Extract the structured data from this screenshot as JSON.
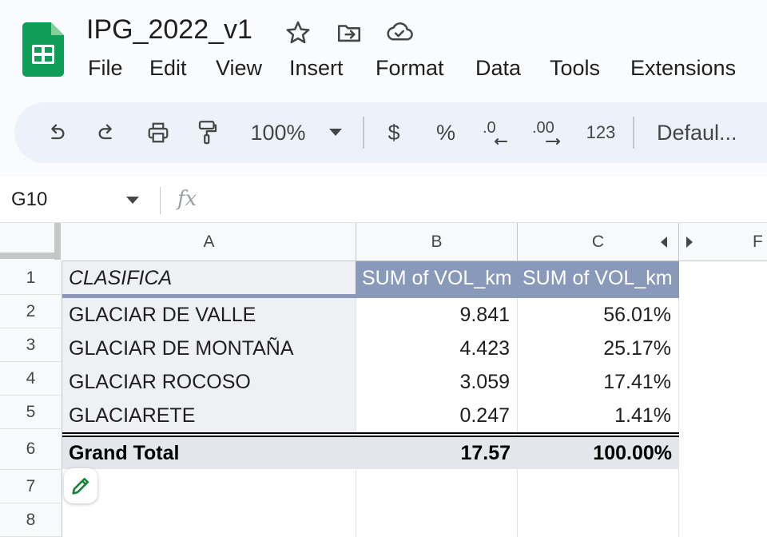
{
  "document": {
    "title": "IPG_2022_v1",
    "icons": [
      "star-icon",
      "move-to-folder-icon",
      "cloud-saved-icon"
    ]
  },
  "menu": [
    "File",
    "Edit",
    "View",
    "Insert",
    "Format",
    "Data",
    "Tools",
    "Extensions"
  ],
  "toolbar": {
    "zoom": "100%",
    "currency": "$",
    "percent": "%",
    "decrease_decimal": ".0",
    "increase_decimal": ".00",
    "number_format": "123",
    "font": "Defaul..."
  },
  "formula_bar": {
    "name_box": "G10",
    "fx": "fx",
    "value": ""
  },
  "sheet": {
    "columns": [
      "A",
      "B",
      "C",
      "F"
    ],
    "rows": [
      "1",
      "2",
      "3",
      "4",
      "5",
      "6",
      "7",
      "8"
    ],
    "header": [
      "CLASIFICA",
      "SUM of VOL_km",
      "SUM of VOL_km"
    ],
    "data": [
      {
        "label": "GLACIAR DE VALLE",
        "b": "9.841",
        "c": "56.01%"
      },
      {
        "label": "GLACIAR DE MONTAÑA",
        "b": "4.423",
        "c": "25.17%"
      },
      {
        "label": "GLACIAR ROCOSO",
        "b": "3.059",
        "c": "17.41%"
      },
      {
        "label": "GLACIARETE",
        "b": "0.247",
        "c": "1.41%"
      }
    ],
    "total": {
      "label": "Grand Total",
      "b": "17.57",
      "c": "100.00%"
    }
  },
  "colors": {
    "pivot_header": "#8899b9",
    "label_cells": "#eef0f4",
    "total_row": "#e3e6eb",
    "sheets_green": "#0f9d58"
  }
}
